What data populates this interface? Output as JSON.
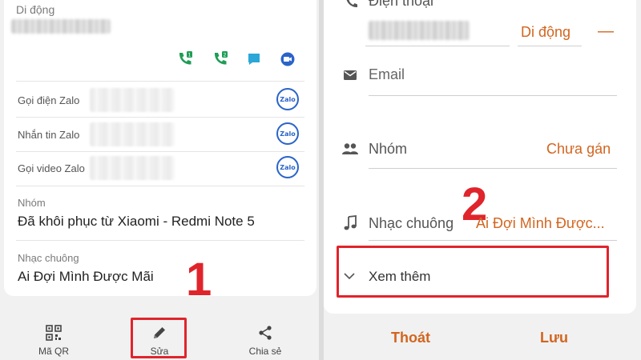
{
  "left": {
    "phone_label": "Di động",
    "zalo_rows": [
      {
        "label": "Gọi điện Zalo",
        "logo": "Zalo"
      },
      {
        "label": "Nhắn tin Zalo",
        "logo": "Zalo"
      },
      {
        "label": "Gọi video Zalo",
        "logo": "Zalo"
      }
    ],
    "group_label": "Nhóm",
    "group_value": "Đã khôi phục từ Xiaomi - Redmi Note 5",
    "ringtone_label": "Nhạc chuông",
    "ringtone_value": "Ai Đợi Mình Được Mãi",
    "bottom_tabs": [
      {
        "label": "Mã QR",
        "icon": "qr-code-icon"
      },
      {
        "label": "Sửa",
        "icon": "pencil-icon"
      },
      {
        "label": "Chia sẻ",
        "icon": "share-icon"
      }
    ],
    "step_number": "1"
  },
  "right": {
    "phone_label": "Điện thoại",
    "phone_type": "Di động",
    "phone_remove": "—",
    "email_placeholder": "Email",
    "group_label": "Nhóm",
    "group_value": "Chưa gán",
    "ringtone_label": "Nhạc chuông",
    "ringtone_value": "Ai Đợi Mình Được...",
    "see_more": "Xem thêm",
    "cancel_button": "Thoát",
    "save_button": "Lưu",
    "step_number": "2"
  },
  "colors": {
    "accent_orange": "#d2651f",
    "highlight_red": "#e0242b",
    "call_green": "#1f9d55",
    "message_teal": "#2aa7d8",
    "zalo_blue": "#2a64c9"
  }
}
